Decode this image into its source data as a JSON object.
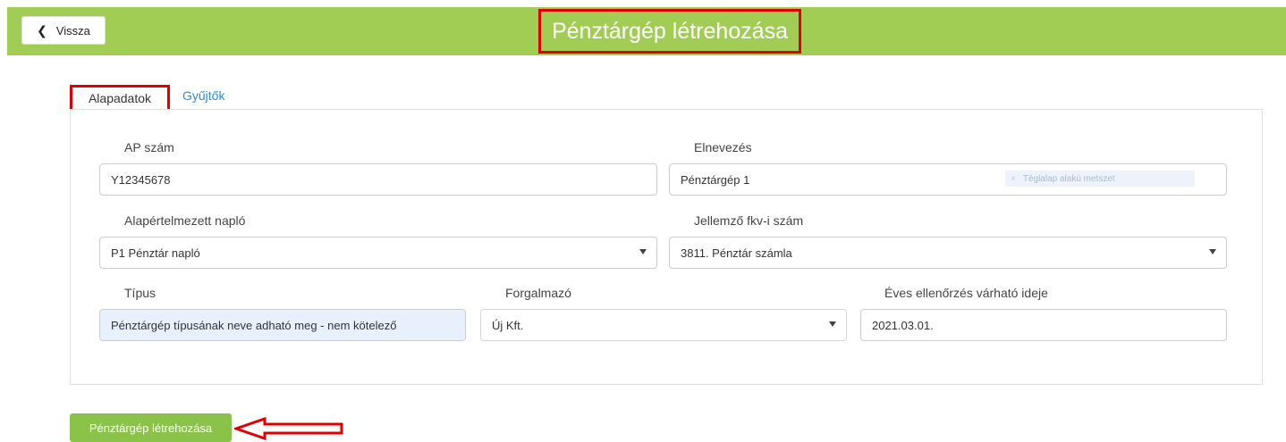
{
  "header": {
    "back_label": "Vissza",
    "title": "Pénztárgép létrehozása"
  },
  "tabs": [
    {
      "label": "Alapadatok",
      "active": true
    },
    {
      "label": "Gyűjtők",
      "active": false
    }
  ],
  "form": {
    "ap_szam": {
      "label": "AP szám",
      "value": "Y12345678"
    },
    "elnevezes": {
      "label": "Elnevezés",
      "value": "Pénztárgép 1"
    },
    "alapertelmezett_naplo": {
      "label": "Alapértelmezett napló",
      "value": "P1 Pénztár napló"
    },
    "jellemzo_fkv": {
      "label": "Jellemző fkv-i szám",
      "value": "3811. Pénztár számla"
    },
    "tipus": {
      "label": "Típus",
      "value": "Pénztárgép típusának neve adható meg - nem kötelező"
    },
    "forgalmazo": {
      "label": "Forgalmazó",
      "value": "Új Kft."
    },
    "eves_ellenorzes": {
      "label": "Éves ellenőrzés várható ideje",
      "value": "2021.03.01."
    }
  },
  "ghost_overlay": {
    "text": "Téglalap alakú metszet"
  },
  "submit_label": "Pénztárgép létrehozása",
  "colors": {
    "header_bg": "#a2cd54",
    "button_bg": "#8bc34a",
    "annotation_red": "#e00000",
    "link_blue": "#2b8bd6"
  }
}
